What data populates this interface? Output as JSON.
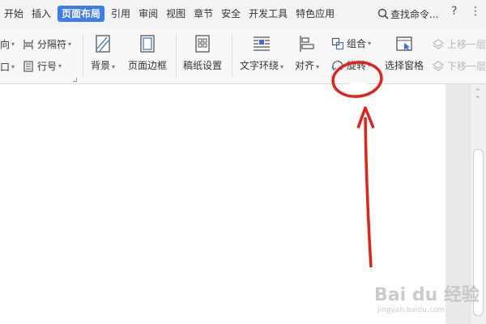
{
  "menubar": {
    "tabs": [
      "开始",
      "插入",
      "页面布局",
      "引用",
      "审阅",
      "视图",
      "章节",
      "安全",
      "开发工具",
      "特色应用"
    ],
    "active_tab": "页面布局",
    "search_label": "查找命令...",
    "help_icon": "question-icon",
    "more_icon": "more-icon"
  },
  "ribbon": {
    "left_cut_1": "向",
    "left_cut_2": "口",
    "separator_label": "分隔符",
    "line_number_label": "行号",
    "background_label": "背景",
    "page_border_label": "页面边框",
    "manuscript_label": "稿纸设置",
    "text_wrap_label": "文字环绕",
    "align_label": "对齐",
    "group_label": "组合",
    "rotate_label": "旋转",
    "selection_pane_label": "选择窗格",
    "bring_forward_label": "上移一层",
    "send_backward_label": "下移一层"
  },
  "watermark": {
    "main": "Bai du 经验",
    "sub": "jingyan.baidu.com"
  },
  "colors": {
    "active_tab": "#3d7bf0",
    "annotation": "#e2231a"
  }
}
